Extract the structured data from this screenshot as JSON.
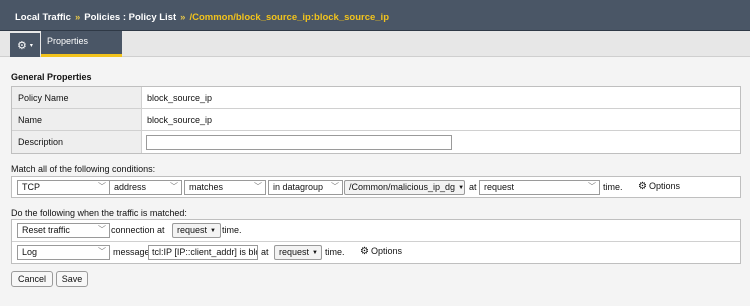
{
  "breadcrumb": {
    "item1": "Local Traffic",
    "sep": "»",
    "item2": "Policies : Policy List",
    "current": "/Common/block_source_ip:block_source_ip"
  },
  "tabs": {
    "gear": "⚙",
    "gear_caret": "▾",
    "properties": "Properties"
  },
  "general": {
    "title": "General Properties",
    "rows": [
      {
        "label": "Policy Name",
        "value": "block_source_ip"
      },
      {
        "label": "Name",
        "value": "block_source_ip"
      },
      {
        "label": "Description",
        "value": ""
      }
    ]
  },
  "conditions": {
    "title": "Match all of the following conditions:",
    "protocol": "TCP",
    "operand": "address",
    "operator": "matches",
    "source": "in datagroup",
    "datagroup": "/Common/malicious_ip_dg",
    "at_label": "at",
    "event": "request",
    "time_label": "time.",
    "options_label": "Options"
  },
  "actions": {
    "title": "Do the following when the traffic is matched:",
    "rows": [
      {
        "action": "Reset traffic",
        "target": "connection at",
        "event": "request",
        "time_label": "time."
      },
      {
        "action": "Log",
        "target": "message",
        "message_value": "tcl:IP [IP::client_addr] is blo",
        "at_label": "at",
        "event": "request",
        "time_label": "time.",
        "options_label": "Options"
      }
    ]
  },
  "buttons": {
    "cancel": "Cancel",
    "save": "Save"
  },
  "icons": {
    "gear": "gear-icon",
    "chevron": "chevron-down-icon"
  },
  "colors": {
    "header": "#4a5666",
    "accent": "#f2c31c"
  }
}
